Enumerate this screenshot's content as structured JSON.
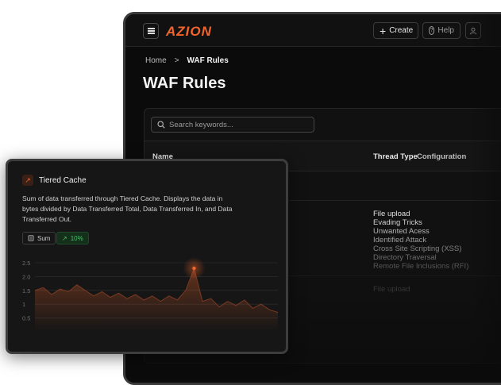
{
  "app": {
    "logo": "AZION"
  },
  "header": {
    "create_label": "Create",
    "help_label": "Help"
  },
  "breadcrumb": {
    "home": "Home",
    "separator": ">",
    "current": "WAF Rules"
  },
  "page": {
    "title": "WAF Rules"
  },
  "search": {
    "placeholder": "Search keywords..."
  },
  "table": {
    "columns": {
      "name": "Name",
      "threat_type": "Thread Type",
      "configuration": "Configuration"
    },
    "threats": [
      "File upload",
      "Evading Tricks",
      "Unwanted Acess",
      "Identified Attack",
      "Cross Site Scripting (XSS)",
      "Directory Traversal",
      "Remote File Inclusions (RFI)"
    ],
    "next_row_threat": "File upload"
  },
  "tiered_cache": {
    "title": "Tiered Cache",
    "description": "Sum of data transferred through Tiered Cache. Displays the data in bytes divided by Data Transferred Total, Data Transferred In, and Data Transferred Out.",
    "aggregation_label": "Sum",
    "change_label": "10%"
  },
  "chart_data": {
    "type": "area",
    "y_ticks": [
      "2.5",
      "2.0",
      "1.5",
      "1",
      "0.5"
    ],
    "y_range": [
      0,
      2.5
    ],
    "series": [
      {
        "values": [
          1.5,
          1.6,
          1.35,
          1.55,
          1.45,
          1.7,
          1.5,
          1.3,
          1.45,
          1.25,
          1.4,
          1.2,
          1.35,
          1.15,
          1.3,
          1.1,
          1.3,
          1.15,
          1.5,
          2.3,
          1.1,
          1.2,
          0.9,
          1.1,
          0.95,
          1.15,
          0.85,
          1.0,
          0.8,
          0.7
        ]
      }
    ],
    "colors": {
      "accent": "#f3652b",
      "positive": "#49c26b"
    }
  }
}
